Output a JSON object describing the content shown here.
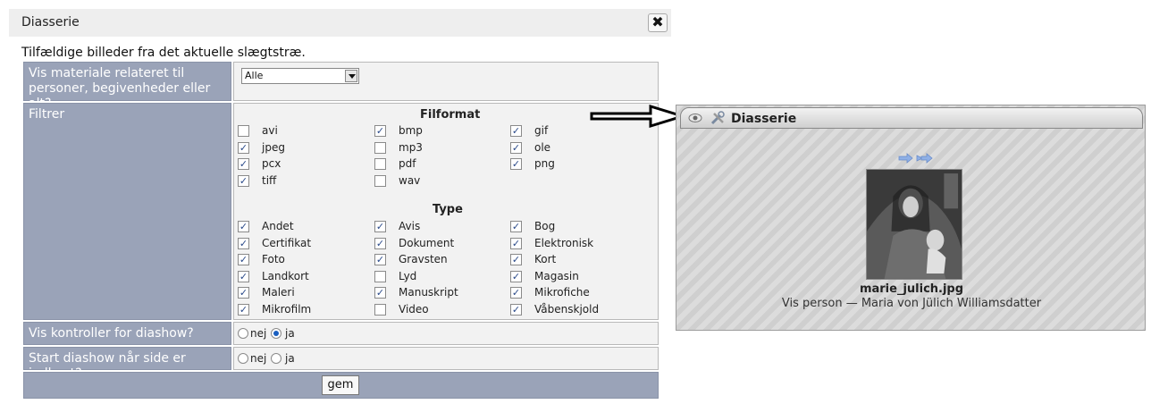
{
  "dialog": {
    "title": "Diasserie",
    "close_glyph": "✖",
    "intro": "Tilfældige billeder fra det aktuelle slægtstræ."
  },
  "rows": {
    "materiale": {
      "label": "Vis materiale relateret til personer, begivenheder eller alt?",
      "select_value": "Alle"
    },
    "filtrer": {
      "label": "Filtrer"
    },
    "kontroller": {
      "label": "Vis kontroller for diashow?",
      "options": [
        "nej",
        "ja"
      ],
      "selected": "ja"
    },
    "start": {
      "label": "Start diashow når side er indlæst?",
      "options": [
        "nej",
        "ja"
      ],
      "selected": null
    }
  },
  "filformat": {
    "heading": "Filformat",
    "items": [
      {
        "label": "avi",
        "checked": false
      },
      {
        "label": "bmp",
        "checked": true
      },
      {
        "label": "gif",
        "checked": true
      },
      {
        "label": "jpeg",
        "checked": true
      },
      {
        "label": "mp3",
        "checked": false
      },
      {
        "label": "ole",
        "checked": true
      },
      {
        "label": "pcx",
        "checked": true
      },
      {
        "label": "pdf",
        "checked": false
      },
      {
        "label": "png",
        "checked": true
      },
      {
        "label": "tiff",
        "checked": true
      },
      {
        "label": "wav",
        "checked": false
      }
    ]
  },
  "type": {
    "heading": "Type",
    "items": [
      {
        "label": "Andet",
        "checked": true
      },
      {
        "label": "Avis",
        "checked": true
      },
      {
        "label": "Bog",
        "checked": true
      },
      {
        "label": "Certifikat",
        "checked": true
      },
      {
        "label": "Dokument",
        "checked": true
      },
      {
        "label": "Elektronisk",
        "checked": true
      },
      {
        "label": "Foto",
        "checked": true
      },
      {
        "label": "Gravsten",
        "checked": true
      },
      {
        "label": "Kort",
        "checked": true
      },
      {
        "label": "Landkort",
        "checked": true
      },
      {
        "label": "Lyd",
        "checked": false
      },
      {
        "label": "Magasin",
        "checked": true
      },
      {
        "label": "Maleri",
        "checked": true
      },
      {
        "label": "Manuskript",
        "checked": true
      },
      {
        "label": "Mikrofiche",
        "checked": true
      },
      {
        "label": "Mikrofilm",
        "checked": true
      },
      {
        "label": "Video",
        "checked": false
      },
      {
        "label": "Våbenskjold",
        "checked": true
      }
    ]
  },
  "save_label": "gem",
  "widget": {
    "title": "Diasserie",
    "file_name": "marie_julich.jpg",
    "person_text": "Vis person — Maria von Jülich Williamsdatter",
    "icons": [
      "eye-icon",
      "tools-icon",
      "next-arrow-icon",
      "last-arrow-icon"
    ]
  },
  "colors": {
    "label_bg": "#9aa3b8",
    "value_bg": "#f2f2f2",
    "checkmark": "#2a4a8a",
    "radio_dot": "#1a5fc0"
  }
}
